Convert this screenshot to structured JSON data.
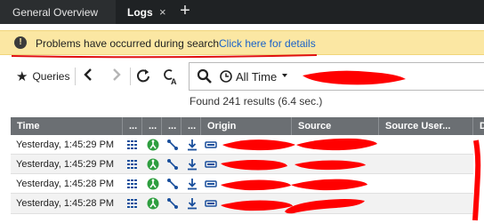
{
  "tabs": [
    {
      "label": "General Overview"
    },
    {
      "label": "Logs",
      "close": "×"
    }
  ],
  "tab_add": "+",
  "banner": {
    "icon": "!",
    "message": "Problems have occurred during search",
    "link": "Click here for details"
  },
  "toolbar": {
    "queries_label": "Queries",
    "icons": [
      "star-icon",
      "back-icon",
      "forward-icon",
      "refresh-icon",
      "case-sensitive-icon"
    ]
  },
  "search": {
    "time_filter": "All Time"
  },
  "results_text": "Found 241 results (6.4 sec.)",
  "table": {
    "columns": [
      "Time",
      "...",
      "...",
      "...",
      "...",
      "Origin",
      "Source",
      "Source User...",
      "D"
    ],
    "rows": [
      {
        "time": "Yesterday, 1:45:29 PM"
      },
      {
        "time": "Yesterday, 1:45:29 PM"
      },
      {
        "time": "Yesterday, 1:45:28 PM"
      },
      {
        "time": "Yesterday, 1:45:28 PM"
      }
    ]
  },
  "colors": {
    "tabstrip": "#1f2224",
    "banner": "#fbe7a3",
    "link": "#1a62c9",
    "header": "#6b6f73",
    "redaction": "#ff0000",
    "green_icon": "#2e9e3f",
    "blue_icon": "#1a4f9c"
  }
}
